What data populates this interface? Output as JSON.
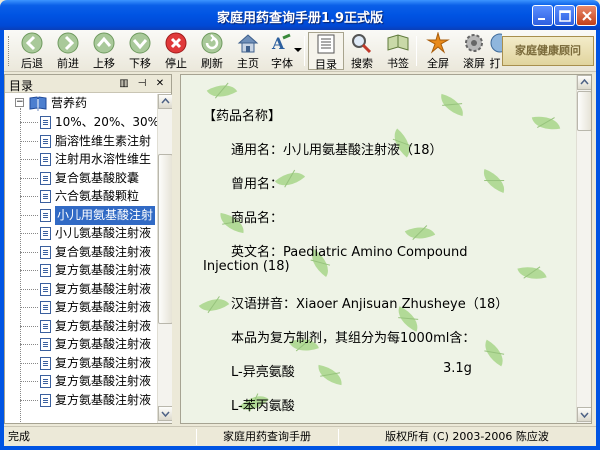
{
  "window": {
    "title": "家庭用药查询手册1.9正式版"
  },
  "toolbar": {
    "buttons": [
      {
        "label": "后退",
        "icon": "back-arrow-icon"
      },
      {
        "label": "前进",
        "icon": "forward-arrow-icon"
      },
      {
        "label": "上移",
        "icon": "up-arrow-icon"
      },
      {
        "label": "下移",
        "icon": "down-arrow-icon"
      },
      {
        "label": "停止",
        "icon": "stop-icon"
      },
      {
        "label": "刷新",
        "icon": "refresh-icon"
      },
      {
        "label": "主页",
        "icon": "home-icon"
      },
      {
        "label": "字体",
        "icon": "font-icon"
      },
      {
        "label": "目录",
        "icon": "contents-icon"
      },
      {
        "label": "搜索",
        "icon": "search-icon"
      },
      {
        "label": "书签",
        "icon": "bookmark-icon"
      },
      {
        "label": "全屏",
        "icon": "fullscreen-icon"
      },
      {
        "label": "滚屏",
        "icon": "scroll-icon"
      },
      {
        "label": "打",
        "icon": "print-icon"
      }
    ],
    "promo_label": "家庭健康顾问"
  },
  "sidebar": {
    "title": "目录",
    "root_label": "营养药",
    "items": [
      {
        "label": "10%、20%、30%"
      },
      {
        "label": "脂溶性维生素注射"
      },
      {
        "label": "注射用水溶性维生"
      },
      {
        "label": "复合氨基酸胶囊"
      },
      {
        "label": "六合氨基酸颗粒"
      },
      {
        "label": "小儿用氨基酸注射",
        "selected": true
      },
      {
        "label": "小儿氨基酸注射液"
      },
      {
        "label": "复合氨基酸注射液"
      },
      {
        "label": "复方氨基酸注射液"
      },
      {
        "label": "复方氨基酸注射液"
      },
      {
        "label": "复方氨基酸注射液"
      },
      {
        "label": "复方氨基酸注射液"
      },
      {
        "label": "复方氨基酸注射液"
      },
      {
        "label": "复方氨基酸注射液"
      },
      {
        "label": "复方氨基酸注射液"
      },
      {
        "label": "复方氨基酸注射液"
      }
    ]
  },
  "content": {
    "section_heading": "【药品名称】",
    "generic_name": "通用名：小儿用氨基酸注射液（18）",
    "former_name": "曾用名：",
    "trade_name": "商品名：",
    "english_name_1": "英文名：Paediatric Amino Compound",
    "english_name_2": "Injection (18)",
    "pinyin": "汉语拼音：Xiaoer Anjisuan Zhusheye（18）",
    "composition": "本品为复方制剂，其组分为每1000ml含：",
    "ingredient_1_name": "L-异亮氨酸",
    "ingredient_1_amount": "3.1g",
    "ingredient_2_name": "L-苯丙氨酸"
  },
  "status": {
    "state": "完成",
    "app_name": "家庭用药查询手册",
    "copyright": "版权所有 (C) 2003-2006 陈应波"
  }
}
